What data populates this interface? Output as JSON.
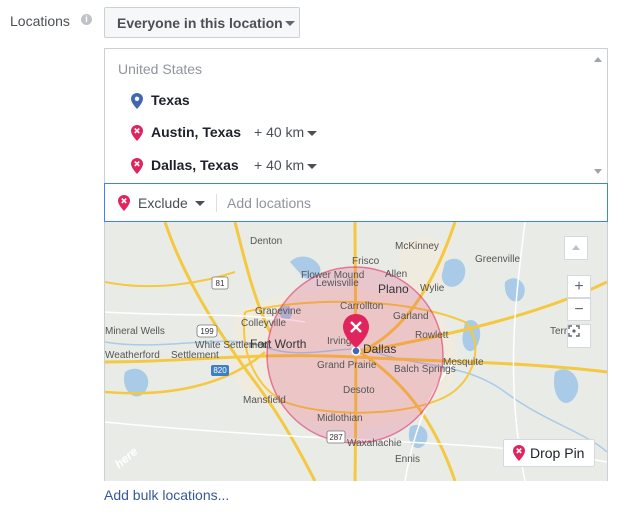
{
  "field": {
    "label": "Locations",
    "info_icon": "info-icon",
    "info_glyph": "i"
  },
  "audience_dropdown": {
    "selected": "Everyone in this location",
    "icon": "chevron-down-icon"
  },
  "locations_list": {
    "country": "United States",
    "items": [
      {
        "name": "Texas",
        "radius": "",
        "pin": "blue-location-pin-icon",
        "color": "#4267b2"
      },
      {
        "name": "Austin, Texas",
        "radius": "+ 40 km",
        "pin": "red-location-pin-icon",
        "color": "#e0245e"
      },
      {
        "name": "Dallas, Texas",
        "radius": "+ 40 km",
        "pin": "red-location-pin-icon",
        "color": "#e0245e"
      }
    ]
  },
  "exclude_bar": {
    "mode": "Exclude",
    "placeholder": "Add locations",
    "value": ""
  },
  "map": {
    "labels": [
      "Denton",
      "McKinney",
      "Frisco",
      "Greenville",
      "Allen",
      "Plano",
      "Wylie",
      "Flower Mound",
      "Lewisville",
      "Carrollton",
      "Grapevine",
      "Colleyville",
      "Garland",
      "Rowlett",
      "Irving",
      "Dallas",
      "Fort Worth",
      "Grand Prairie",
      "Mesquite",
      "Balch Springs",
      "White Settlement",
      "Settlement",
      "Mineral Wells",
      "Weatherford",
      "Mansfield",
      "Desoto",
      "Midlothian",
      "Waxahachie",
      "Ennis",
      "Terrell"
    ],
    "highway_shields": [
      "81",
      "199",
      "820",
      "287"
    ],
    "radius_color": "#e0245e",
    "zoom_in": "+",
    "zoom_out": "−",
    "drop_pin_label": "Drop Pin",
    "attribution": "here"
  },
  "bulk_link": "Add bulk locations..."
}
